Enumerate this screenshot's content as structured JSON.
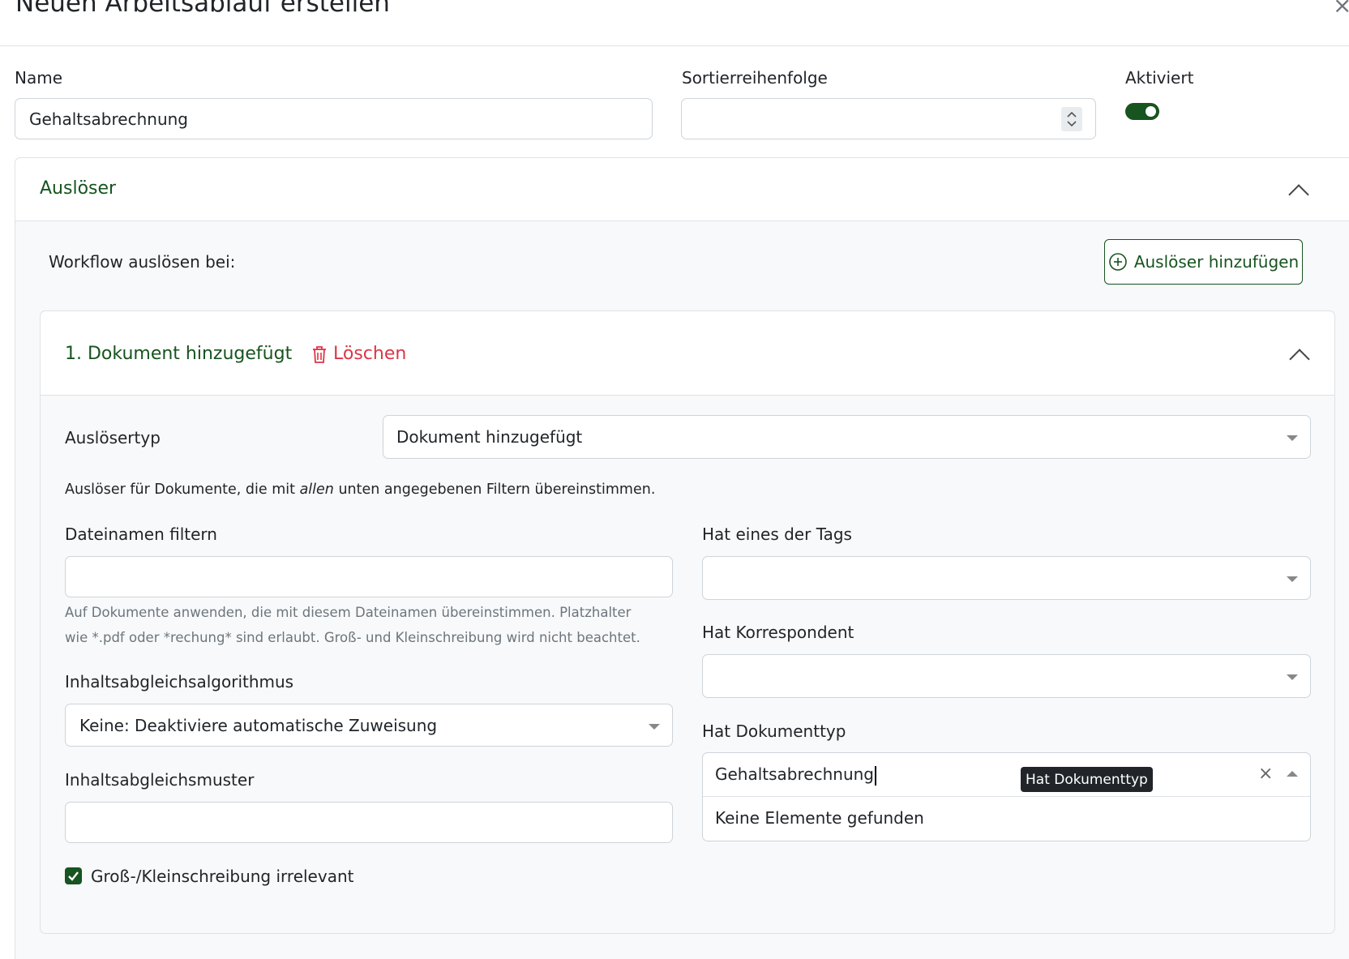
{
  "modal": {
    "title": "Neuen Arbeitsablauf erstellen",
    "close": "×"
  },
  "form": {
    "name_label": "Name",
    "name_value": "Gehaltsabrechnung",
    "sort_label": "Sortierreihenfolge",
    "sort_value": "",
    "enabled_label": "Aktiviert",
    "enabled": true
  },
  "triggers": {
    "section_title": "Auslöser",
    "intro": "Workflow auslösen bei:",
    "add_button": "Auslöser hinzufügen",
    "items": [
      {
        "title": "1. Dokument hinzugefügt",
        "delete_label": "Löschen",
        "type_label": "Auslösertyp",
        "type_value": "Dokument hinzugefügt",
        "description_pre": "Auslöser für Dokumente, die mit ",
        "description_em": "allen",
        "description_post": " unten angegebenen Filtern übereinstimmen.",
        "filename_label": "Dateinamen filtern",
        "filename_value": "",
        "filename_hint": "Auf Dokumente anwenden, die mit diesem Dateinamen übereinstimmen. Platzhalter wie *.pdf oder *rechung* sind erlaubt. Groß- und Kleinschreibung wird nicht beachtet.",
        "matching_algo_label": "Inhaltsabgleichsalgorithmus",
        "matching_algo_value": "Keine: Deaktiviere automatische Zuweisung",
        "matching_pattern_label": "Inhaltsabgleichsmuster",
        "matching_pattern_value": "",
        "case_insensitive_label": "Groß-/Kleinschreibung irrelevant",
        "case_insensitive": true,
        "tags_label": "Hat eines der Tags",
        "correspondent_label": "Hat Korrespondent",
        "doctype_label": "Hat Dokumenttyp",
        "doctype_search": "Gehaltsabrechnung",
        "doctype_tooltip": "Hat Dokumenttyp",
        "doctype_empty": "Keine Elemente gefunden"
      }
    ]
  },
  "colors": {
    "accent": "#17541f",
    "danger": "#dc3545"
  }
}
